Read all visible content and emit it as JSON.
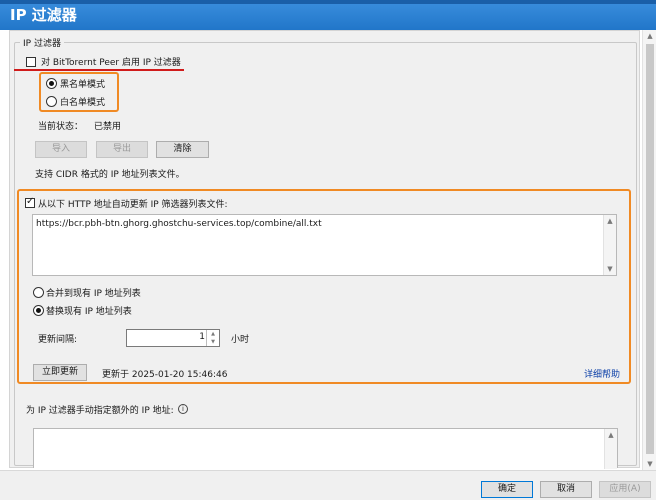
{
  "window": {
    "title": "IP 过滤器"
  },
  "group": {
    "title": "IP 过滤器"
  },
  "enable_filter": {
    "label": "对 BitTorernt Peer 启用 IP 过滤器",
    "checked": false
  },
  "mode": {
    "blacklist_label": "黑名单模式",
    "whitelist_label": "白名单模式",
    "selected": "blacklist"
  },
  "status": {
    "label": "当前状态：",
    "value": "已禁用"
  },
  "buttons": {
    "import": "导入",
    "export": "导出",
    "clear": "清除"
  },
  "cidr_note": "支持 CIDR 格式的 IP 地址列表文件。",
  "auto_update": {
    "label": "从以下 HTTP 地址自动更新 IP 筛选器列表文件:",
    "checked": true,
    "url": "https://bcr.pbh-btn.ghorg.ghostchu-services.top/combine/all.txt",
    "merge_label": "合并到现有 IP 地址列表",
    "replace_label": "替换现有 IP 地址列表",
    "selected": "replace",
    "interval_label": "更新间隔:",
    "interval_value": "1",
    "interval_unit": "小时",
    "update_now": "立即更新",
    "last_updated": "更新于 2025-01-20 15:46:46",
    "help_link": "详细帮助"
  },
  "manual": {
    "label": "为 IP 过滤器手动指定额外的 IP 地址:",
    "info_icon": "info-icon"
  },
  "footer": {
    "ok": "确定",
    "cancel": "取消",
    "apply": "应用(A)"
  },
  "colors": {
    "highlight": "#f08a24",
    "underline": "#d01b1b",
    "titlebar": "#2176c9"
  }
}
